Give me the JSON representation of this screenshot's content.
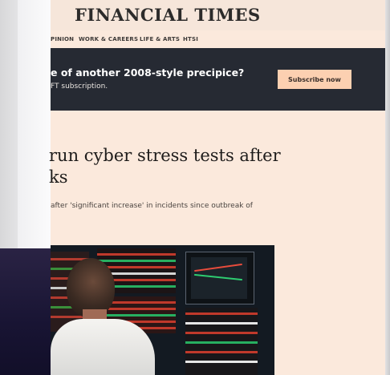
{
  "masthead": {
    "brand": "FINANCIAL TIMES"
  },
  "nav": [
    "PINION",
    "WORK & CAREERS",
    "LIFE & ARTS",
    "HTSI"
  ],
  "banner": {
    "headline": "e of another 2008-style precipice?",
    "sub": "FT subscription.",
    "button": "Subscribe now"
  },
  "article": {
    "title_lines": [
      "run cyber stress tests after",
      "ks"
    ],
    "standfirst": "after 'significant increase' in incidents since outbreak of"
  },
  "colors": {
    "page_bg": "#fbe9dc",
    "banner_bg": "#262a33",
    "button_bg": "#fcd0b1"
  }
}
